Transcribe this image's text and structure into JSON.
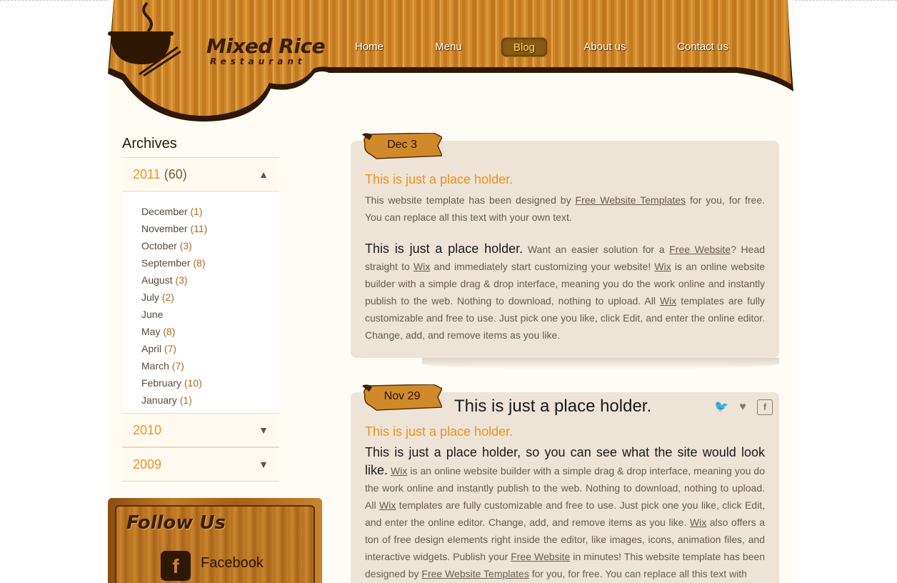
{
  "brand": {
    "name": "Mixed Rice",
    "subtitle": "Restaurant"
  },
  "nav": {
    "items": [
      "Home",
      "Menu",
      "Blog",
      "About us",
      "Contact us"
    ],
    "active": "Blog"
  },
  "colors": {
    "accent": "#f09020",
    "wood": "#c8842e",
    "dark_brown": "#3a1e08",
    "post_bg": "#ede4d7"
  },
  "sidebar": {
    "archives_title": "Archives",
    "years": [
      {
        "label": "2011",
        "count": "(60)",
        "expanded": true,
        "icon": "arrow-up-icon"
      },
      {
        "label": "2010",
        "expanded": false,
        "icon": "arrow-down-icon"
      },
      {
        "label": "2009",
        "expanded": false,
        "icon": "arrow-down-icon"
      }
    ],
    "months": [
      {
        "name": "December",
        "count": "(1)"
      },
      {
        "name": "November",
        "count": "(11)"
      },
      {
        "name": "October",
        "count": "(3)"
      },
      {
        "name": "September",
        "count": "(8)"
      },
      {
        "name": "August",
        "count": "(3)"
      },
      {
        "name": "July",
        "count": "(2)"
      },
      {
        "name": "June",
        "count": ""
      },
      {
        "name": "May",
        "count": "(8)"
      },
      {
        "name": "April",
        "count": "(7)"
      },
      {
        "name": "March",
        "count": "(7)"
      },
      {
        "name": "February",
        "count": "(10)"
      },
      {
        "name": "January",
        "count": "(1)"
      }
    ],
    "follow": {
      "title": "Follow Us",
      "facebook_label": "Facebook",
      "facebook_glyph": "f"
    }
  },
  "posts": [
    {
      "date": "Dec 3",
      "subtitle": "This is just a place holder.",
      "p1": {
        "t1": "This website template has been designed by ",
        "l1": "Free Website Templates",
        "t2": " for you, for free. You can replace all this text with your own text."
      },
      "p2": {
        "big": "This is just a place holder.",
        "t1": " Want an easier solution for a ",
        "l1": "Free Website",
        "t2": "? Head straight to ",
        "l2": "Wix",
        "t3": " and immediately start customizing your website! ",
        "l3": "Wix",
        "t4": " is an online website builder with a simple drag & drop interface, meaning you do the work online and instantly publish to the web. Nothing to download, nothing to upload. All ",
        "l4": "Wix",
        "t5": " templates are fully customizable and free to use. Just pick one you like, click Edit, and enter the online editor. Change, add, and remove items as you like."
      }
    },
    {
      "date": "Nov 29",
      "title": "This is just a place holder.",
      "social_icons": [
        "twitter-icon",
        "heart-icon",
        "facebook-icon"
      ],
      "social_glyphs": {
        "twitter": "🐦",
        "heart": "♥",
        "facebook": "f"
      },
      "subtitle": "This is just a place holder.",
      "p1": {
        "big": "This is just a place holder, so you can see what the site would look like.",
        "t0": " ",
        "l1": "Wix",
        "t1": " is an online website builder with a simple drag & drop interface, meaning you do the work online and instantly publish to the web. Nothing to download, nothing to upload. All ",
        "l2": "Wix",
        "t2": " templates are fully customizable and free to use. Just pick one you like, click Edit, and enter the online editor. Change, add, and remove items as you like. ",
        "l3": "Wix",
        "t3": " also offers a ton of free design elements right inside the editor, like images, icons, animation files, and interactive widgets. Publish your ",
        "l4": "Free Website",
        "t4": " in minutes! This website template has been designed by ",
        "l5": "Free Website Templates",
        "t5": " for you, for free. You can replace all this text with"
      }
    }
  ]
}
